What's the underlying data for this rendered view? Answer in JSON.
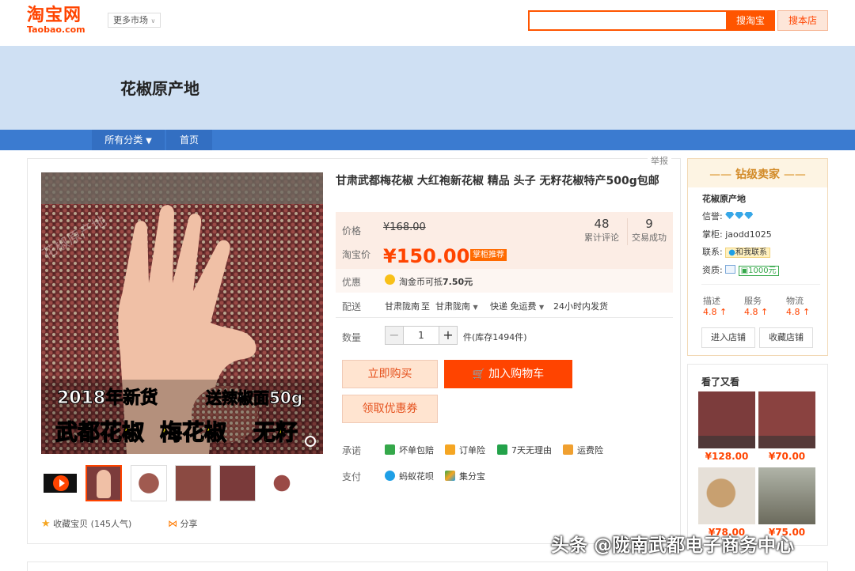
{
  "header": {
    "logo_cn": "淘宝网",
    "logo_en": "Taobao.com",
    "more_market": "更多市场",
    "search_taobao_btn": "搜淘宝",
    "search_shop_btn": "搜本店"
  },
  "shop": {
    "title": "花椒原产地",
    "nav_all": "所有分类",
    "nav_home": "首页"
  },
  "report": "举报",
  "image_overlay": {
    "line1_left": "2018年新货",
    "line1_right": "送辣椒面50g",
    "line2_a": "武都花椒",
    "line2_b": "梅花椒",
    "line2_c": "无籽",
    "watermark": "花椒原产地"
  },
  "product": {
    "title": "甘肃武都梅花椒 大红袍新花椒 精品 头子 无籽花椒特产500g包邮",
    "price_label": "价格",
    "original_price": "¥168.00",
    "tb_price_label": "淘宝价",
    "tb_price": "¥150.00",
    "tb_price_badge": "掌柜推荐",
    "reviews_count": "48",
    "reviews_label": "累计评论",
    "deals_count": "9",
    "deals_label": "交易成功",
    "promo_label": "优惠",
    "promo_text": "淘金币可抵",
    "promo_value": "7.50元",
    "ship_label": "配送",
    "ship_from": "甘肃陇南",
    "ship_to_word": "至",
    "ship_to": "甘肃陇南",
    "ship_method": "快递 免运费",
    "ship_time": "24小时内发货",
    "qty_label": "数量",
    "qty_value": "1",
    "qty_minus": "−",
    "qty_plus": "+",
    "stock": "件(库存1494件)",
    "buy_now": "立即购买",
    "add_cart": "加入购物车",
    "get_coupon": "领取优惠券",
    "promise_label": "承诺",
    "promises": [
      "坏单包赔",
      "订单险",
      "7天无理由",
      "运费险"
    ],
    "pay_label": "支付",
    "payments": [
      "蚂蚁花呗",
      "集分宝"
    ],
    "favorite": "收藏宝贝 (145人气)",
    "share": "分享"
  },
  "seller": {
    "rank": "钻级卖家",
    "shop_name": "花椒原产地",
    "credit_label": "信誉:",
    "owner_label": "掌柜:",
    "owner": "jaodd1025",
    "contact_label": "联系:",
    "contact_btn": "和我联系",
    "qual_label": "资质:",
    "qual_value": "1000元",
    "score_desc_label": "描述",
    "score_desc": "4.8",
    "score_serv_label": "服务",
    "score_serv": "4.8",
    "score_ship_label": "物流",
    "score_ship": "4.8",
    "enter_shop": "进入店铺",
    "fav_shop": "收藏店铺"
  },
  "seen": {
    "title": "看了又看",
    "items": [
      {
        "price": "¥128.00"
      },
      {
        "price": "¥70.00"
      },
      {
        "price": "¥78.00"
      },
      {
        "price": "¥75.00"
      }
    ]
  },
  "watermark": "头条 @陇南武都电子商务中心",
  "colors": {
    "accent": "#ff4400",
    "nav_blue": "#3b7bd0",
    "banner": "#cfe0f3"
  }
}
